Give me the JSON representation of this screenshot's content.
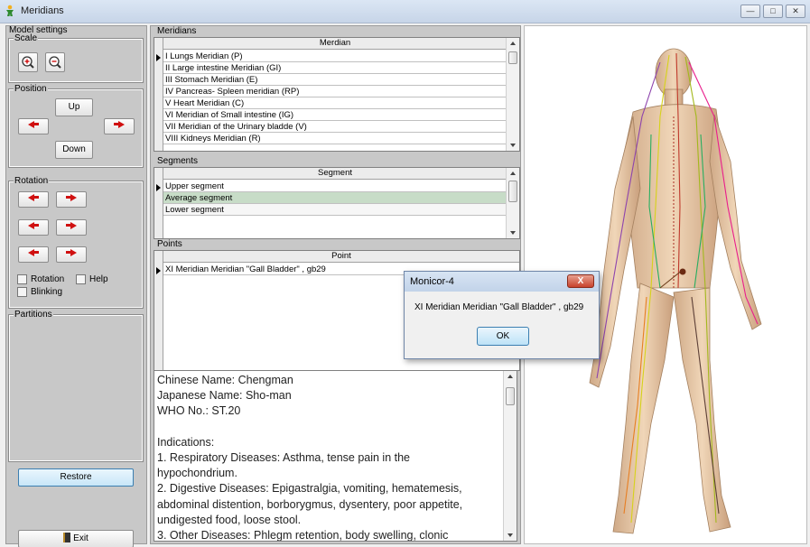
{
  "window": {
    "title": "Meridians",
    "icon": "app-figure-icon"
  },
  "model_settings": {
    "title": "Model settings",
    "scale": {
      "label": "Scale",
      "zoom_in_icon": "zoom-in-icon",
      "zoom_out_icon": "zoom-out-icon"
    },
    "position": {
      "label": "Position",
      "up": "Up",
      "down": "Down"
    },
    "rotation": {
      "label": "Rotation"
    },
    "checks": {
      "rotation": "Rotation",
      "help": "Help",
      "blinking": "Blinking"
    },
    "partitions": {
      "label": "Partitions"
    },
    "restore": "Restore",
    "exit": "Exit"
  },
  "meridians": {
    "label": "Meridians",
    "header": "Merdian",
    "rows": [
      "I Lungs Meridian (P)",
      "II Large intestine Meridian (GI)",
      "III Stomach Meridian (E)",
      "IV Pancreas- Spleen meridian (RP)",
      "V Heart Meridian (C)",
      "VI Meridian of Small intestine (IG)",
      "VII Meridian of the Urinary bladde (V)",
      "VIII Kidneys Meridian (R)"
    ]
  },
  "segments": {
    "label": "Segments",
    "header": "Segment",
    "rows": [
      "Upper segment",
      "Average segment",
      "Lower segment"
    ]
  },
  "points": {
    "label": "Points",
    "header": "Point",
    "rows": [
      "XI Meridian Meridian \"Gall Bladder\" , gb29"
    ]
  },
  "info": {
    "lines": [
      "Chinese Name: Chengman",
      "Japanese Name: Sho-man",
      "WHO No.: ST.20",
      "",
      "Indications:",
      "1. Respiratory Diseases: Asthma, tense pain in the",
      "hypochondrium.",
      "2. Digestive Diseases: Epigastralgia, vomiting, hematemesis,",
      "abdominal distention, borborygmus, dysentery, poor appetite,",
      "undigested food, loose stool.",
      "3. Other Diseases: Phlegm retention, body swelling, clonic"
    ]
  },
  "dialog": {
    "title": "Monicor-4",
    "message": "XI Meridian Meridian \"Gall Bladder\" , gb29",
    "ok": "OK",
    "close": "X"
  },
  "colors": {
    "selected_row": "#c7dcc7",
    "arrow": "#d01010",
    "skin": "#e6c8a6"
  }
}
